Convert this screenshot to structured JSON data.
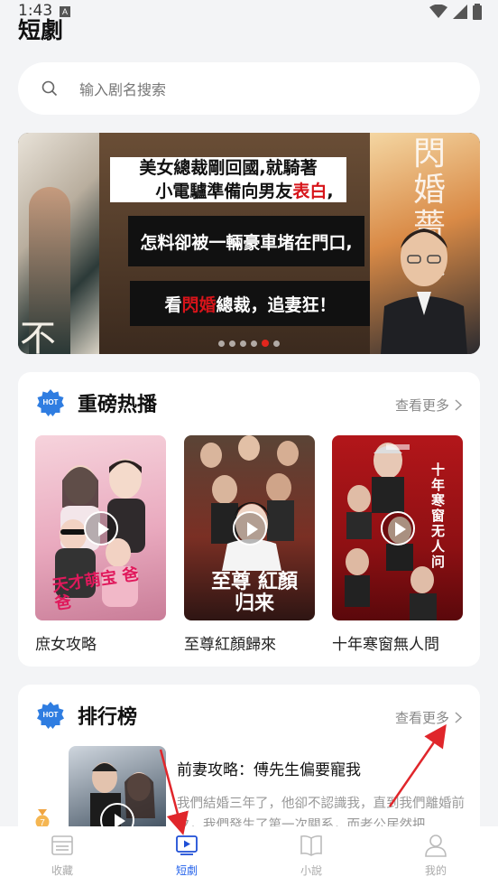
{
  "status": {
    "time": "1:43",
    "badge": "A"
  },
  "header": {
    "title": "短劇"
  },
  "search": {
    "placeholder": "输入剧名搜索"
  },
  "banner": {
    "caption_line1a": "美女總裁剛回國,就騎著",
    "caption_line1b_pre": "小電驢準備向男友",
    "caption_line1b_red": "表白",
    "caption_line1b_post": ",",
    "caption_line2": "怎料卻被一輛豪車堵在門口,",
    "caption_line3_pre": "看",
    "caption_line3_red": "閃婚",
    "caption_line3_post": "總裁，追妻狂！",
    "right_title_art": "閃婚薔薇",
    "left_title_art": "不",
    "dots": 6,
    "active_dot": 4
  },
  "hot_section": {
    "badge": "HOT",
    "title": "重磅热播",
    "more": "查看更多",
    "items": [
      {
        "name": "庶女攻略",
        "poster_text": "天才萌宝 爸爸"
      },
      {
        "name": "至尊紅顏歸來",
        "poster_text": "至尊 紅顏 归来"
      },
      {
        "name": "十年寒窗無人問",
        "poster_text": "十年寒窗无人问"
      }
    ]
  },
  "ranking_section": {
    "badge": "HOT",
    "title": "排行榜",
    "more": "查看更多",
    "items": [
      {
        "title": "前妻攻略：傅先生偏要寵我",
        "desc": "我們結婚三年了，他卻不認識我，直到我們離婚前夕，我們發生了第一次關系，而老公居然把"
      }
    ]
  },
  "tabbar": {
    "items": [
      {
        "label": "收藏",
        "icon": "collection-icon"
      },
      {
        "label": "短劇",
        "icon": "video-icon"
      },
      {
        "label": "小說",
        "icon": "book-icon"
      },
      {
        "label": "我的",
        "icon": "person-icon"
      }
    ],
    "active": 1
  },
  "colors": {
    "accent": "#2563eb",
    "hot_badge": "#2f7de1",
    "banner_red": "#d7141a",
    "annotation_arrow": "#e0262b"
  }
}
